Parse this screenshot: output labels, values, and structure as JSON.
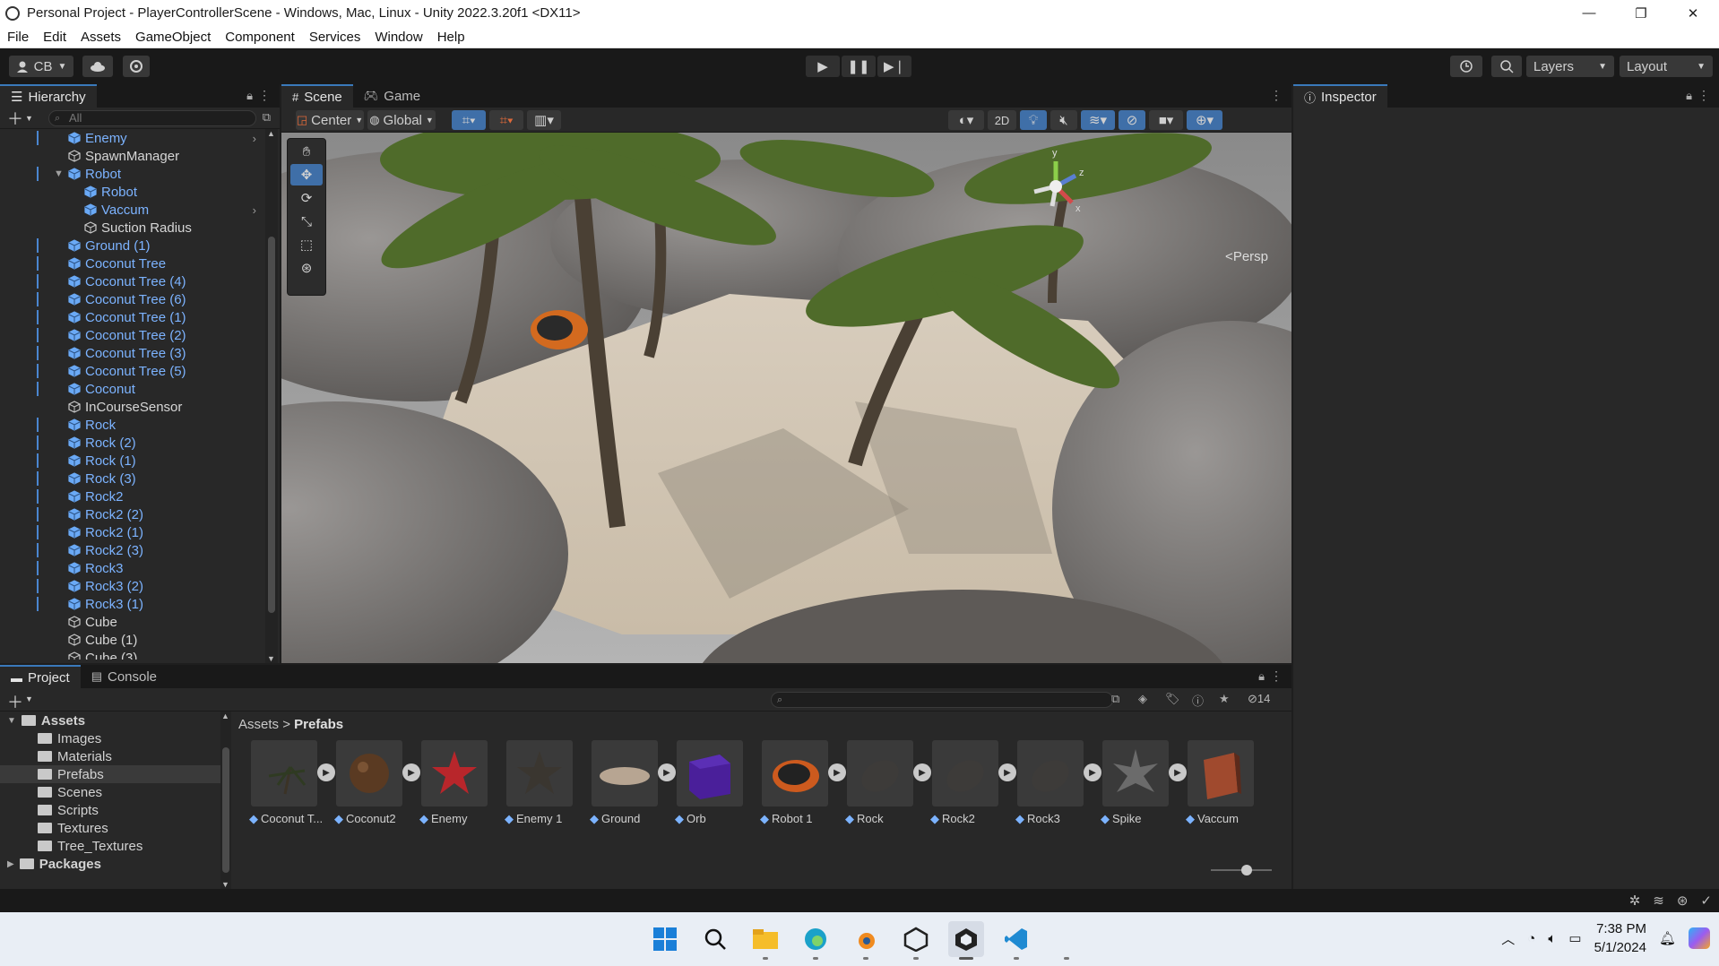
{
  "window": {
    "title": "Personal Project - PlayerControllerScene - Windows, Mac, Linux - Unity 2022.3.20f1 <DX11>",
    "minimize": "—",
    "maximize": "❐",
    "close": "✕"
  },
  "menu": [
    "File",
    "Edit",
    "Assets",
    "GameObject",
    "Component",
    "Services",
    "Window",
    "Help"
  ],
  "toolbar": {
    "account": "CB",
    "layers": "Layers",
    "layout": "Layout"
  },
  "hierarchy": {
    "tab": "Hierarchy",
    "search_placeholder": "All",
    "items": [
      {
        "label": "Enemy",
        "color": "blue",
        "indent": 1,
        "chevron": true
      },
      {
        "label": "SpawnManager",
        "color": "white",
        "indent": 1
      },
      {
        "label": "Robot",
        "color": "blue",
        "indent": 1,
        "expanded": true
      },
      {
        "label": "Robot",
        "color": "blue",
        "indent": 2
      },
      {
        "label": "Vaccum",
        "color": "blue",
        "indent": 2,
        "chevron": true
      },
      {
        "label": "Suction Radius",
        "color": "white",
        "indent": 2
      },
      {
        "label": "Ground (1)",
        "color": "blue",
        "indent": 1
      },
      {
        "label": "Coconut Tree",
        "color": "blue",
        "indent": 1
      },
      {
        "label": "Coconut Tree (4)",
        "color": "blue",
        "indent": 1
      },
      {
        "label": "Coconut Tree (6)",
        "color": "blue",
        "indent": 1
      },
      {
        "label": "Coconut Tree (1)",
        "color": "blue",
        "indent": 1
      },
      {
        "label": "Coconut Tree (2)",
        "color": "blue",
        "indent": 1
      },
      {
        "label": "Coconut Tree (3)",
        "color": "blue",
        "indent": 1
      },
      {
        "label": "Coconut Tree (5)",
        "color": "blue",
        "indent": 1
      },
      {
        "label": "Coconut",
        "color": "blue",
        "indent": 1
      },
      {
        "label": "InCourseSensor",
        "color": "white",
        "indent": 1
      },
      {
        "label": "Rock",
        "color": "blue",
        "indent": 1
      },
      {
        "label": "Rock (2)",
        "color": "blue",
        "indent": 1
      },
      {
        "label": "Rock (1)",
        "color": "blue",
        "indent": 1
      },
      {
        "label": "Rock (3)",
        "color": "blue",
        "indent": 1
      },
      {
        "label": "Rock2",
        "color": "blue",
        "indent": 1
      },
      {
        "label": "Rock2 (2)",
        "color": "blue",
        "indent": 1
      },
      {
        "label": "Rock2 (1)",
        "color": "blue",
        "indent": 1
      },
      {
        "label": "Rock2 (3)",
        "color": "blue",
        "indent": 1
      },
      {
        "label": "Rock3",
        "color": "blue",
        "indent": 1
      },
      {
        "label": "Rock3 (2)",
        "color": "blue",
        "indent": 1
      },
      {
        "label": "Rock3 (1)",
        "color": "blue",
        "indent": 1
      },
      {
        "label": "Cube",
        "color": "white",
        "indent": 1
      },
      {
        "label": "Cube (1)",
        "color": "white",
        "indent": 1
      },
      {
        "label": "Cube (3)",
        "color": "white",
        "indent": 1
      }
    ]
  },
  "scene": {
    "tabs": [
      "Scene",
      "Game"
    ],
    "pivot": "Center",
    "space": "Global",
    "mode_2d": "2D",
    "camera_label": "Persp"
  },
  "inspector": {
    "tab": "Inspector"
  },
  "project": {
    "tabs": [
      "Project",
      "Console"
    ],
    "tree": [
      {
        "label": "Assets",
        "level": 0,
        "bold": true
      },
      {
        "label": "Images",
        "level": 1
      },
      {
        "label": "Materials",
        "level": 1
      },
      {
        "label": "Prefabs",
        "level": 1,
        "selected": true
      },
      {
        "label": "Scenes",
        "level": 1
      },
      {
        "label": "Scripts",
        "level": 1
      },
      {
        "label": "Textures",
        "level": 1
      },
      {
        "label": "Tree_Textures",
        "level": 1
      },
      {
        "label": "Packages",
        "level": 0,
        "bold": true
      }
    ],
    "breadcrumb_root": "Assets",
    "breadcrumb_current": "Prefabs",
    "hidden_count": "14",
    "assets": [
      {
        "label": "Coconut T...",
        "icon": "tree-icon",
        "play": true
      },
      {
        "label": "Coconut2",
        "icon": "coconut-icon",
        "play": true
      },
      {
        "label": "Enemy",
        "icon": "star-red-icon",
        "play": false
      },
      {
        "label": "Enemy 1",
        "icon": "star-dark-icon",
        "play": false
      },
      {
        "label": "Ground",
        "icon": "disc-icon",
        "play": true
      },
      {
        "label": "Orb",
        "icon": "purple-cube-icon",
        "play": false
      },
      {
        "label": "Robot 1",
        "icon": "robot-icon",
        "play": true
      },
      {
        "label": "Rock",
        "icon": "rock-icon",
        "play": true
      },
      {
        "label": "Rock2",
        "icon": "rock-icon",
        "play": true
      },
      {
        "label": "Rock3",
        "icon": "rock-icon",
        "play": true
      },
      {
        "label": "Spike",
        "icon": "spike-icon",
        "play": true
      },
      {
        "label": "Vaccum",
        "icon": "vaccum-icon",
        "play": false
      }
    ]
  },
  "taskbar": {
    "time": "7:38 PM",
    "date": "5/1/2024"
  },
  "colors": {
    "accent": "#3a79bb",
    "prefab_blue": "#7cb3ff"
  }
}
